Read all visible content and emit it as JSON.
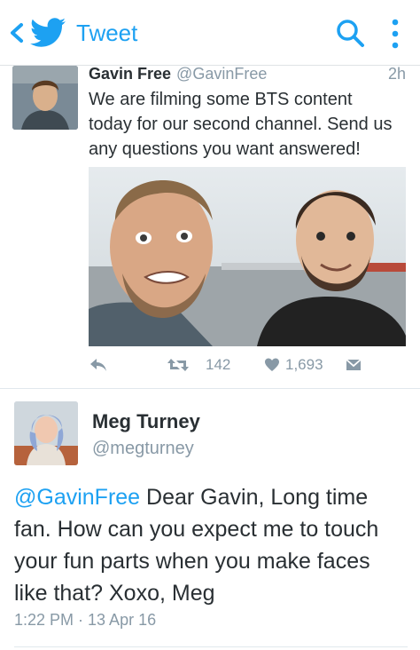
{
  "header": {
    "title": "Tweet",
    "back_icon": "chevron-left-icon",
    "logo_icon": "twitter-bird-icon",
    "search_icon": "search-icon",
    "menu_icon": "more-vertical-icon",
    "accent": "#1da1f2"
  },
  "tweet1": {
    "name": "Gavin Free",
    "handle": "@GavinFree",
    "time": "2h",
    "text_lines": [
      "We are filming some BTS content",
      "today for our second channel. Send us",
      "any questions you want answered!"
    ],
    "retweets": "142",
    "likes": "1,693"
  },
  "tweet2": {
    "name": "Meg Turney",
    "handle": "@megturney",
    "mention": "@GavinFree",
    "text_lines": [
      " Dear Gavin, Long time",
      "fan. How can you expect me to touch",
      "your fun parts when you make faces",
      "like that? Xoxo, Meg"
    ],
    "timestamp": "1:22 PM · 13 Apr 16"
  }
}
